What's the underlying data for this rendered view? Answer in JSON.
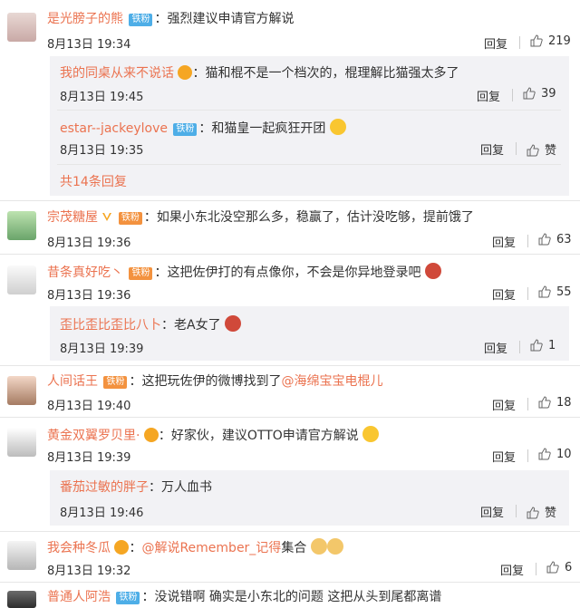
{
  "comments": [
    {
      "name": "是光膀子的熊",
      "badge": "铁粉",
      "text": "强烈建议申请官方解说",
      "time": "8月13日 19:34",
      "reply": "回复",
      "likes": "219"
    },
    {
      "name": "我的同桌从来不说话",
      "text": "猫和棍不是一个档次的，棍理解比猫强太多了",
      "time": "8月13日 19:45",
      "reply": "回复",
      "likes": "39"
    },
    {
      "name": "estar--jackeylove",
      "badge": "铁粉",
      "text": "和猫皇一起疯狂开团",
      "time": "8月13日 19:35",
      "reply": "回复",
      "likes": "赞"
    },
    {
      "more": "共14条回复"
    },
    {
      "name": "宗茂糖屋",
      "badge": "铁粉",
      "text": "如果小东北没空那么多，稳赢了，估计没吃够，提前饿了",
      "time": "8月13日 19:36",
      "reply": "回复",
      "likes": "63"
    },
    {
      "name": "昔条真好吃丶",
      "badge": "铁粉",
      "text": "这把佐伊打的有点像你，不会是你异地登录吧",
      "time": "8月13日 19:36",
      "reply": "回复",
      "likes": "55"
    },
    {
      "name": "歪比歪比歪比八卜",
      "text": "老A女了",
      "time": "8月13日 19:39",
      "reply": "回复",
      "likes": "1"
    },
    {
      "name": "人间话王",
      "badge": "铁粉",
      "text": "这把玩佐伊的微博找到了",
      "mention": "@海绵宝宝电棍儿",
      "time": "8月13日 19:40",
      "reply": "回复",
      "likes": "18"
    },
    {
      "name": "黄金双翼罗贝里·",
      "text": "好家伙，建议OTTO申请官方解说",
      "time": "8月13日 19:39",
      "reply": "回复",
      "likes": "10"
    },
    {
      "name": "番茄过敏的胖子",
      "text": "万人血书",
      "time": "8月13日 19:46",
      "reply": "回复",
      "likes": "赞"
    },
    {
      "name": "我会种冬瓜",
      "mention": "@解说Remember_记得",
      "text": "集合",
      "time": "8月13日 19:32",
      "reply": "回复",
      "likes": "6"
    },
    {
      "name": "普通人阿浩",
      "badge": "铁粉",
      "text": "没说错啊 确实是小东北的问题 这把从头到尾都离谱"
    }
  ]
}
